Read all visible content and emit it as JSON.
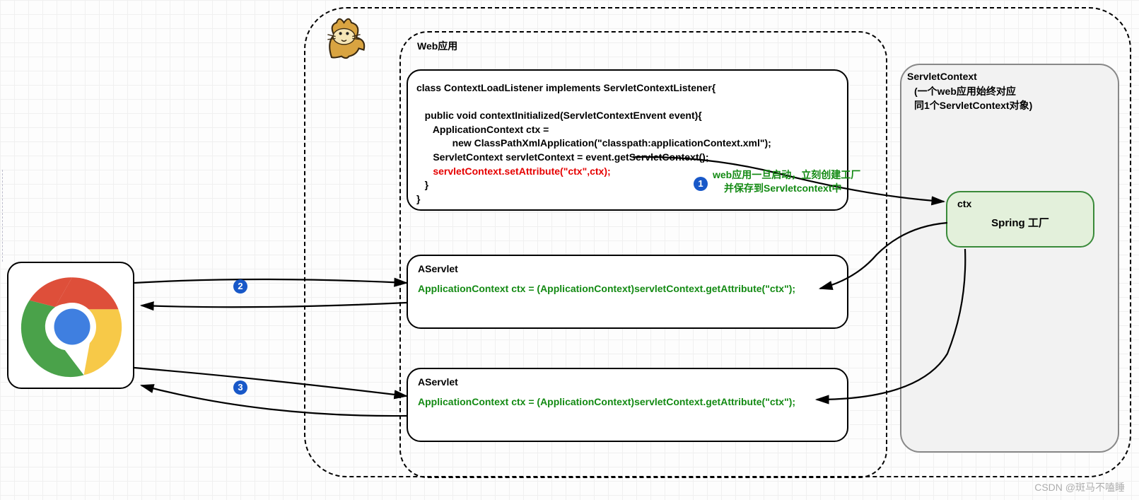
{
  "webapp_label": "Web应用",
  "listener_code_l1": "class ContextLoadListener implements ServletContextListener{",
  "listener_code_l2": "   public void contextInitialized(ServletContextEnvent event){",
  "listener_code_l3": "      ApplicationContext ctx =",
  "listener_code_l4": "             new ClassPathXmlApplication(\"classpath:applicationContext.xml\");",
  "listener_code_l5": "      ServletContext servletContext = event.getServletContext();",
  "listener_code_red": "      servletContext.setAttribute(\"ctx\",ctx);",
  "listener_code_l6": "   }",
  "listener_code_l7": "}",
  "note_startup_l1": "web应用一旦启动，立刻创建工厂",
  "note_startup_l2": "并保存到Servletcontext中",
  "servlet_a": {
    "title": "AServlet",
    "body": "ApplicationContext ctx = (ApplicationContext)servletContext.getAttribute(\"ctx\");"
  },
  "servlet_b": {
    "title": "AServlet",
    "body": "ApplicationContext ctx = (ApplicationContext)servletContext.getAttribute(\"ctx\");"
  },
  "servletcontext_title": "ServletContext",
  "servletcontext_sub_l1": "(一个web应用始终对应",
  "servletcontext_sub_l2": "  同1个ServletContext对象)",
  "ctx_box": {
    "t1": "ctx",
    "t2": "Spring 工厂"
  },
  "circles": {
    "c1": "1",
    "c2": "2",
    "c3": "3"
  },
  "watermark": "CSDN @斑马不嗑睡"
}
